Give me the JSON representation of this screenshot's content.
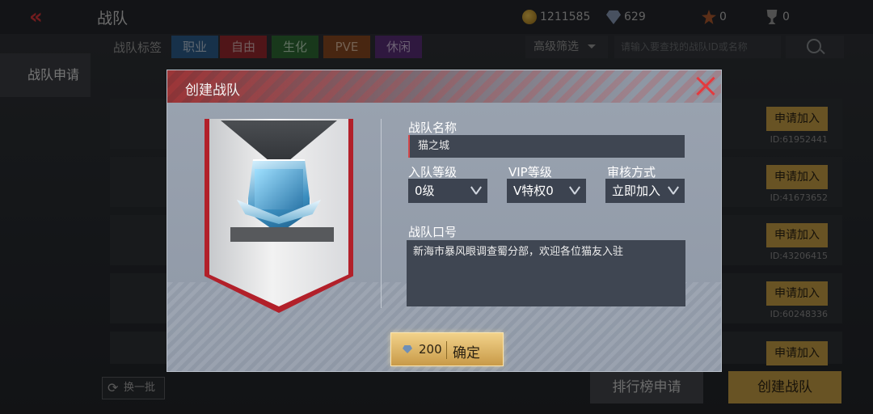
{
  "header": {
    "title": "战队",
    "back_icon": "chevron-left-double-icon",
    "resources": [
      {
        "icon": "coin-icon",
        "value": "1211585"
      },
      {
        "icon": "diamond-icon",
        "value": "629"
      },
      {
        "icon": "medal-icon",
        "value": "0"
      },
      {
        "icon": "trophy-icon",
        "value": "0"
      }
    ]
  },
  "filters": {
    "label": "战队标签",
    "tags": [
      {
        "label": "职业",
        "color": "#2d5f8f"
      },
      {
        "label": "自由",
        "color": "#9a2a2e"
      },
      {
        "label": "生化",
        "color": "#2f6b35"
      },
      {
        "label": "PVE",
        "color": "#8a4a21"
      },
      {
        "label": "休闲",
        "color": "#5b2f7a"
      }
    ],
    "advanced_label": "高级筛选",
    "search_placeholder": "请输入要查找的战队ID或名称"
  },
  "sidebar": {
    "active_tab": "战队申请"
  },
  "rows": [
    {
      "apply_label": "申请加入",
      "id_text": "ID:61952441"
    },
    {
      "apply_label": "申请加入",
      "id_text": "ID:41673652"
    },
    {
      "apply_label": "申请加入",
      "id_text": "ID:43206415"
    },
    {
      "apply_label": "申请加入",
      "id_text": "ID:60248336"
    },
    {
      "apply_label": "申请加入",
      "id_text": ""
    }
  ],
  "bottom": {
    "refresh_label": "换一批",
    "rank_label": "排行榜申请",
    "create_label": "创建战队"
  },
  "modal": {
    "title": "创建战队",
    "name_label": "战队名称",
    "name_value": "猫之城",
    "level_label": "入队等级",
    "level_value": "0级",
    "vip_label": "VIP等级",
    "vip_value": "V特权0",
    "review_label": "审核方式",
    "review_value": "立即加入",
    "slogan_label": "战队口号",
    "slogan_value": "新海市暴风眼调查蜀分部，欢迎各位猫友入驻",
    "confirm_price": "200",
    "confirm_label": "确定"
  },
  "colors": {
    "accent_red": "#d2363a",
    "gold": "#c89f45"
  }
}
